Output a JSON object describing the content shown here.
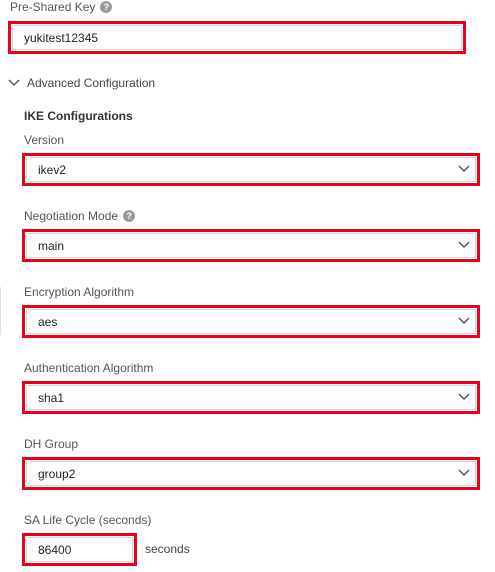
{
  "psk": {
    "label": "Pre-Shared Key",
    "value": "yukitest12345"
  },
  "advanced": {
    "toggle_label": "Advanced Configuration",
    "expanded": true
  },
  "ike": {
    "heading": "IKE Configurations",
    "version": {
      "label": "Version",
      "value": "ikev2"
    },
    "negotiation_mode": {
      "label": "Negotiation Mode",
      "value": "main"
    },
    "encryption_algorithm": {
      "label": "Encryption Algorithm",
      "value": "aes"
    },
    "authentication_algorithm": {
      "label": "Authentication Algorithm",
      "value": "sha1"
    },
    "dh_group": {
      "label": "DH Group",
      "value": "group2"
    },
    "sa_life_cycle": {
      "label": "SA Life Cycle (seconds)",
      "value": "86400",
      "suffix": "seconds"
    }
  },
  "colors": {
    "highlight_border": "#e8001c",
    "input_border": "#d6d6d6",
    "label_text": "#555555",
    "help_icon": "#9b9b9b"
  },
  "icons": {
    "help": "question-circle",
    "toggle": "chevron-down",
    "select": "chevron-down"
  }
}
